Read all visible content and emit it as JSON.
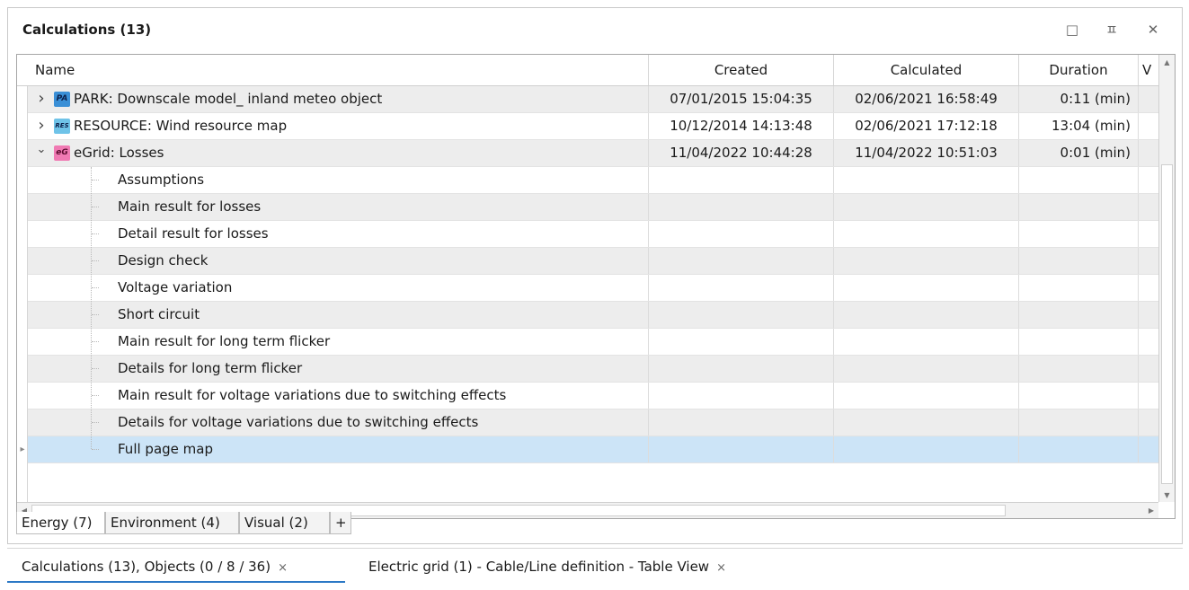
{
  "panel": {
    "title": "Calculations (13)",
    "controls": {
      "maximize": "□",
      "pin": "ㅍ",
      "close": "✕"
    }
  },
  "grid": {
    "columns": [
      {
        "key": "name",
        "label": "Name"
      },
      {
        "key": "created",
        "label": "Created"
      },
      {
        "key": "calculated",
        "label": "Calculated"
      },
      {
        "key": "duration",
        "label": "Duration"
      },
      {
        "key": "v",
        "label": "V"
      }
    ],
    "parents": [
      {
        "icon": "PA",
        "icon_bg": "#3a8fd6",
        "icon_fg": "#0b1f4a",
        "expanded": false,
        "name": "PARK: Downscale model_ inland meteo object",
        "created": "07/01/2015 15:04:35",
        "calculated": "02/06/2021 16:58:49",
        "duration": "0:11 (min)"
      },
      {
        "icon": "RES",
        "icon_bg": "#6fc3e8",
        "icon_fg": "#0b1f4a",
        "expanded": false,
        "name": "RESOURCE: Wind resource map",
        "created": "10/12/2014 14:13:48",
        "calculated": "02/06/2021 17:12:18",
        "duration": "13:04 (min)"
      },
      {
        "icon": "eG",
        "icon_bg": "#f07ab3",
        "icon_fg": "#5a0a2e",
        "expanded": true,
        "name": "eGrid: Losses",
        "created": "11/04/2022 10:44:28",
        "calculated": "11/04/2022 10:51:03",
        "duration": "0:01 (min)"
      }
    ],
    "children": [
      "Assumptions",
      "Main result for losses",
      "Detail result for losses",
      "Design check",
      "Voltage variation",
      "Short circuit",
      "Main result for long term flicker",
      "Details for long term flicker",
      "Main result for voltage variations due to switching effects",
      "Details for voltage variations due to switching effects",
      "Full page map"
    ],
    "selected_child": "Full page map"
  },
  "sheet_tabs": [
    {
      "label": "Energy (7)",
      "active": true
    },
    {
      "label": "Environment (4)",
      "active": false
    },
    {
      "label": "Visual (2)",
      "active": false
    },
    {
      "label": "+",
      "active": false
    }
  ],
  "doc_tabs": [
    {
      "label": "Calculations (13), Objects (0 / 8 / 36)",
      "active": true
    },
    {
      "label": "Electric grid (1) - Cable/Line definition - Table View",
      "active": false
    }
  ],
  "glyphs": {
    "close": "×",
    "collapsed": "›",
    "expanded": "⌄",
    "scroll_up": "▲",
    "scroll_down": "▼",
    "scroll_left": "◀",
    "scroll_right": "▶",
    "new_row": "✱",
    "row_pointer": "▸"
  }
}
